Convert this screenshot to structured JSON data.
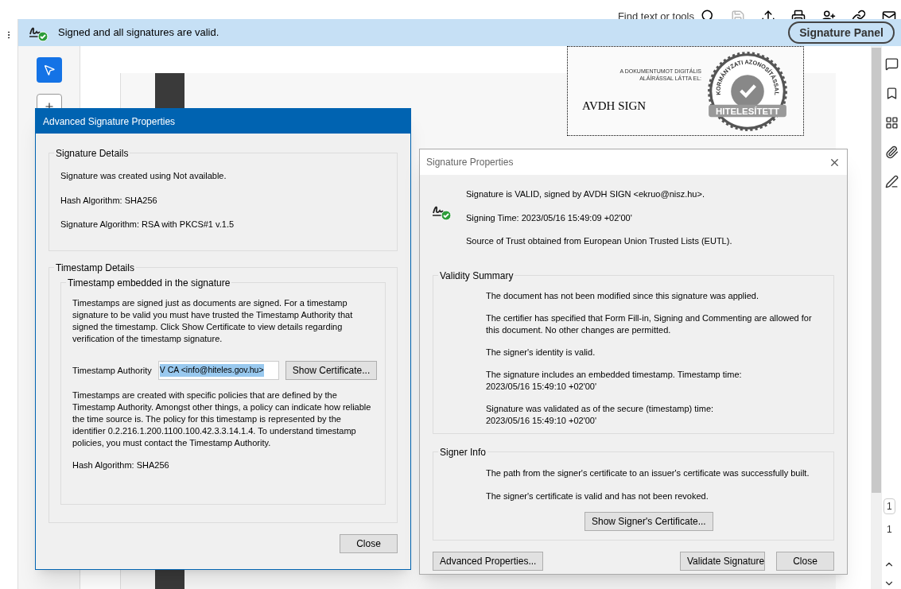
{
  "toolbar": {
    "search_placeholder": "Find text or tools"
  },
  "signature_bar": {
    "message": "Signed and all signatures are valid.",
    "button": "Signature Panel"
  },
  "tools": [
    {
      "selected": true
    },
    {
      "selected": false
    }
  ],
  "stamp": {
    "caption_lines": [
      "A DOKUMENTUMOT DIGITÁLIS",
      "ALÁÍRÁSSAL LÁTTA EL:"
    ],
    "signer": "AVDH SIGN",
    "seal_ring": "KORMÁNYZATI AZONOSÍTÁSSAL",
    "seal_banner": "HITELESÍTETT"
  },
  "page_counter": {
    "current": "1",
    "total": "1"
  },
  "advanced_dialog": {
    "title": "Advanced Signature Properties",
    "signature_details": {
      "legend": "Signature Details",
      "lines": [
        "Signature was created using Not available.",
        "Hash Algorithm: SHA256",
        "Signature Algorithm: RSA with PKCS#1 v.1.5"
      ]
    },
    "timestamp_details": {
      "legend": "Timestamp Details",
      "inner_legend": "Timestamp embedded in the signature",
      "intro": "Timestamps are signed just as documents are signed. For a timestamp signature to be valid you must have trusted the Timestamp Authority that signed the timestamp. Click Show Certificate to view details regarding verification of the timestamp signature.",
      "authority_label": "Timestamp Authority",
      "authority_value": "V CA <info@hiteles.gov.hu>",
      "show_certificate": "Show Certificate...",
      "policy": "Timestamps are created with specific policies that are defined by the Timestamp Authority. Amongst other things, a policy can indicate how reliable the time source is. The policy for this timestamp is represented by the identifier 0.2.216.1.200.1100.100.42.3.3.14.1.4. To understand timestamp policies, you must contact the Timestamp Authority.",
      "hash": "Hash Algorithm: SHA256"
    },
    "close": "Close"
  },
  "properties_dialog": {
    "title": "Signature Properties",
    "header_lines": [
      "Signature is VALID, signed by AVDH SIGN <ekruo@nisz.hu>.",
      "Signing Time:  2023/05/16 15:49:09 +02'00'",
      "Source of Trust obtained from European Union Trusted Lists (EUTL)."
    ],
    "validity": {
      "legend": "Validity Summary",
      "lines": [
        [
          "The document has not been modified since this signature was applied."
        ],
        [
          "The certifier has specified that Form Fill-in, Signing and Commenting are allowed for",
          "this document. No other changes are permitted."
        ],
        [
          "The signer's identity is valid."
        ],
        [
          "The signature includes an embedded timestamp. Timestamp time:",
          "2023/05/16 15:49:10 +02'00'"
        ],
        [
          "Signature was validated as of the secure (timestamp) time:",
          "2023/05/16 15:49:10 +02'00'"
        ]
      ]
    },
    "signer_info": {
      "legend": "Signer Info",
      "lines": [
        "The path from the signer's certificate to an issuer's certificate was successfully built.",
        "The signer's certificate is valid and has not been revoked."
      ],
      "button": "Show Signer's Certificate..."
    },
    "buttons": {
      "advanced": "Advanced Properties...",
      "validate": "Validate Signature",
      "close": "Close"
    }
  }
}
